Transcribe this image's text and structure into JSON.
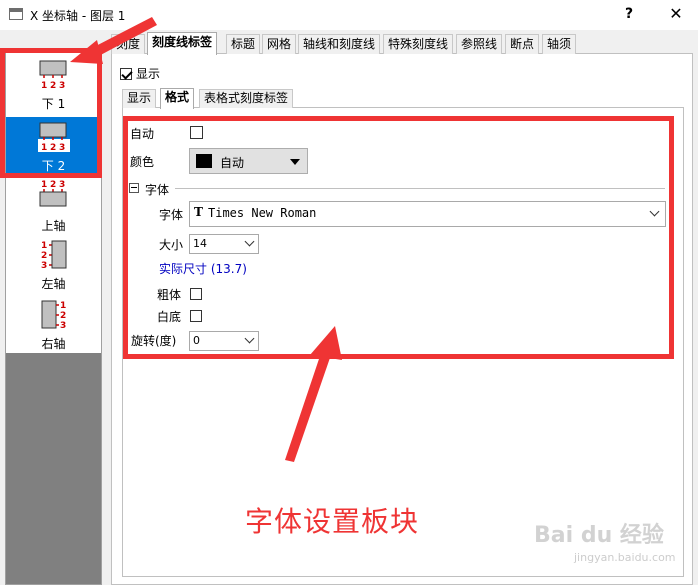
{
  "window": {
    "title": "X 坐标轴 - 图层 1",
    "help": "?",
    "close": "✕"
  },
  "axis_list": [
    {
      "label": "下 1",
      "selected": false
    },
    {
      "label": "下 2",
      "selected": true
    },
    {
      "label": "上轴",
      "selected": false
    },
    {
      "label": "左轴",
      "selected": false
    },
    {
      "label": "右轴",
      "selected": false
    }
  ],
  "tick_label_numbers": [
    "1",
    "2",
    "3"
  ],
  "tabs": [
    "刻度",
    "刻度线标签",
    "标题",
    "网格",
    "轴线和刻度线",
    "特殊刻度线",
    "参照线",
    "断点",
    "轴须"
  ],
  "active_tab": "刻度线标签",
  "show": {
    "label": "显示",
    "checked": true
  },
  "subtabs": [
    "显示",
    "格式",
    "表格式刻度标签"
  ],
  "active_subtab": "格式",
  "form": {
    "auto": {
      "label": "自动",
      "checked": false
    },
    "color": {
      "label": "颜色",
      "value": "自动",
      "swatch": "#000000"
    },
    "font_group": {
      "label": "字体"
    },
    "font": {
      "label": "字体",
      "icon": "T",
      "value": "Times New Roman"
    },
    "size": {
      "label": "大小",
      "value": "14"
    },
    "actual_size": "实际尺寸 (13.7)",
    "bold": {
      "label": "粗体",
      "checked": false
    },
    "white_bg": {
      "label": "白底",
      "checked": false
    },
    "rotation": {
      "label": "旋转(度)",
      "value": "0"
    }
  },
  "annotation": {
    "caption": "字体设置板块",
    "color": "#ef3434"
  },
  "watermark": {
    "text": "Bai du 经验",
    "sub": "jingyan.baidu.com"
  }
}
